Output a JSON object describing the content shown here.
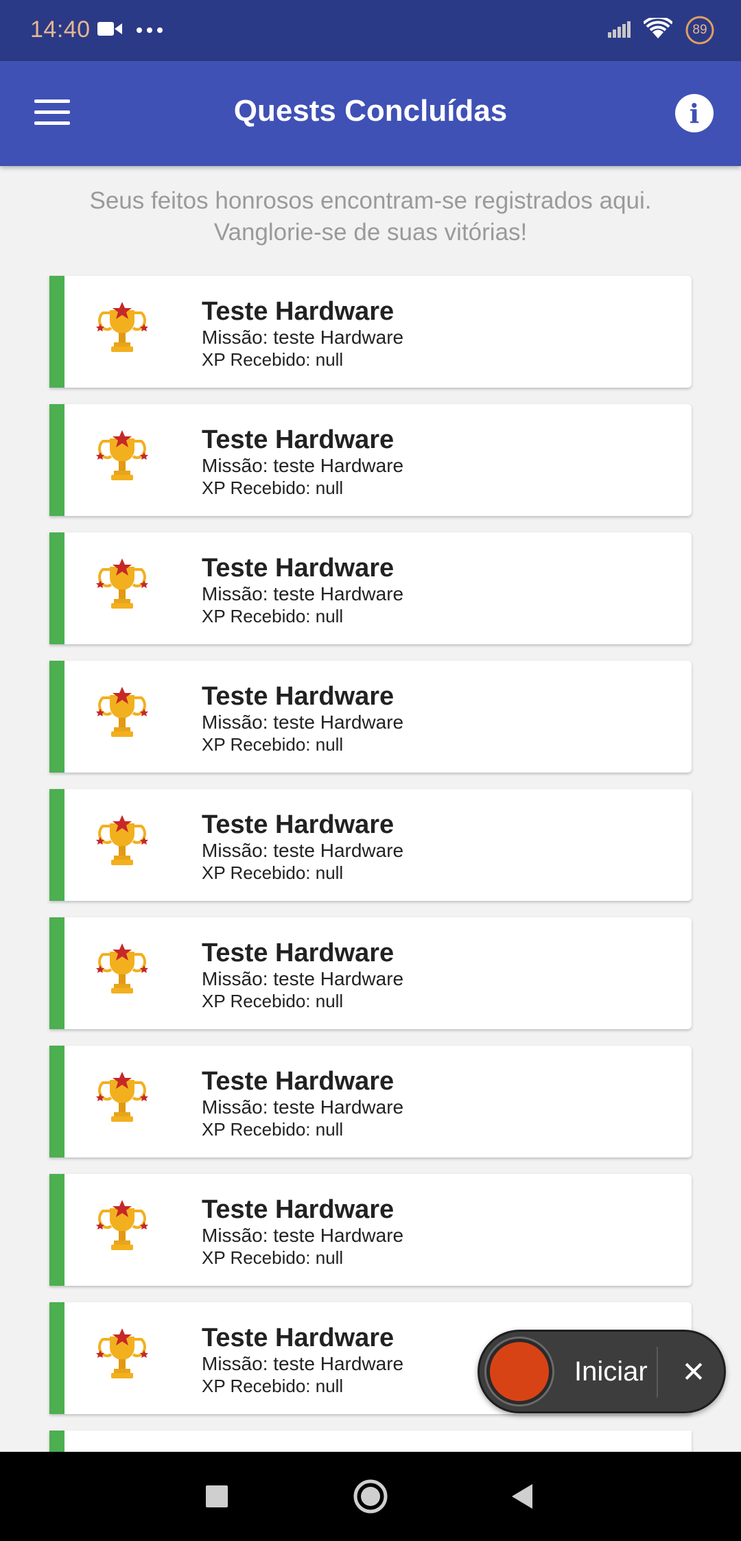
{
  "status_bar": {
    "time": "14:40",
    "battery_level": "89",
    "left_icons": [
      "video-camera-icon",
      "more-dots-icon"
    ],
    "right_icons": [
      "signal-icon",
      "wifi-icon",
      "battery-icon"
    ]
  },
  "app_bar": {
    "title": "Quests Concluídas",
    "menu_icon": "hamburger-menu-icon",
    "info_icon": "info-icon",
    "info_glyph": "i",
    "color": "#3f51b5"
  },
  "subtitle": {
    "line1": "Seus feitos honrosos encontram-se registrados aqui.",
    "line2": "Vanglorie-se de suas vitórias!"
  },
  "quests": [
    {
      "title": "Teste Hardware",
      "mission": "Missão: teste Hardware",
      "xp": "XP Recebido: null"
    },
    {
      "title": "Teste Hardware",
      "mission": "Missão: teste Hardware",
      "xp": "XP Recebido: null"
    },
    {
      "title": "Teste Hardware",
      "mission": "Missão: teste Hardware",
      "xp": "XP Recebido: null"
    },
    {
      "title": "Teste Hardware",
      "mission": "Missão: teste Hardware",
      "xp": "XP Recebido: null"
    },
    {
      "title": "Teste Hardware",
      "mission": "Missão: teste Hardware",
      "xp": "XP Recebido: null"
    },
    {
      "title": "Teste Hardware",
      "mission": "Missão: teste Hardware",
      "xp": "XP Recebido: null"
    },
    {
      "title": "Teste Hardware",
      "mission": "Missão: teste Hardware",
      "xp": "XP Recebido: null"
    },
    {
      "title": "Teste Hardware",
      "mission": "Missão: teste Hardware",
      "xp": "XP Recebido: null"
    },
    {
      "title": "Teste Hardware",
      "mission": "Missão: teste Hardware",
      "xp": "XP Recebido: null"
    }
  ],
  "quest_icon": "trophy-icon",
  "quest_accent_color": "#4caf50",
  "recorder": {
    "start_label": "Iniciar",
    "close_glyph": "✕",
    "record_color": "#d84315"
  },
  "nav_bar": {
    "buttons": [
      "recent-apps-icon",
      "home-icon",
      "back-icon"
    ]
  }
}
